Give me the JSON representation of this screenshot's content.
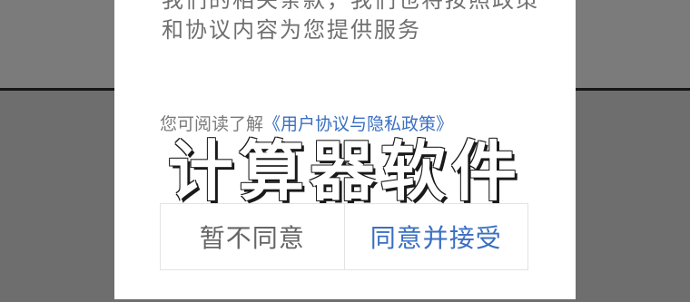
{
  "dialog": {
    "body_text": "我们的相关条款，我们也将按照政策和协议内容为您提供服务",
    "read_prefix": "您可阅读了解",
    "policy_link": "《用户协议与隐私政策》",
    "buttons": {
      "decline": "暂不同意",
      "accept": "同意并接受"
    }
  },
  "watermark": "计算器软件",
  "colors": {
    "link": "#3a6fc2",
    "body_text": "#6f6f6f",
    "backdrop": "#7b7b7b"
  }
}
